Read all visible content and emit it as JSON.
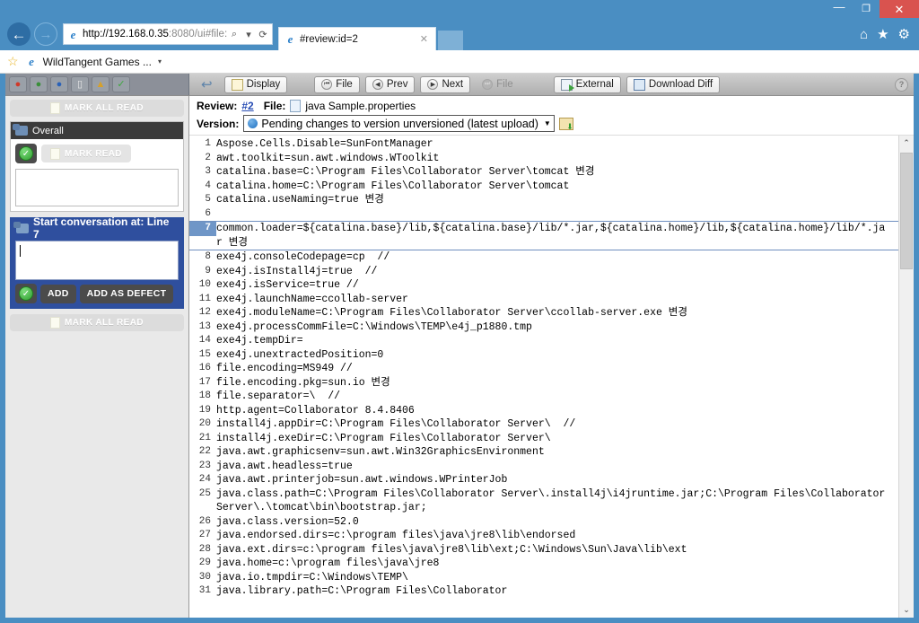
{
  "browser": {
    "window_controls": {
      "minimize": "—",
      "maximize": "❐",
      "close": "✕"
    },
    "back_arrow": "←",
    "forward_arrow": "→",
    "url_host": "http://192.168.0.35",
    "url_path": ":8080/ui#file:",
    "search_glyph": "⌕",
    "dropdown_glyph": "▾",
    "refresh_glyph": "⟳",
    "tab_title": "#review:id=2",
    "tab_close": "✕",
    "home_icon": "⌂",
    "favorites_icon": "★",
    "settings_icon": "⚙",
    "favbar": {
      "star": "☆",
      "item_label": "WildTangent Games ...",
      "caret": "▾"
    }
  },
  "toolbar": {
    "left_icons": [
      {
        "name": "defect-red-icon",
        "glyph": "🐞"
      },
      {
        "name": "defect-fixed-icon",
        "glyph": "🐞"
      },
      {
        "name": "defect-next-icon",
        "glyph": "🐞"
      },
      {
        "name": "comment-icon",
        "glyph": "💬"
      },
      {
        "name": "alert-icon",
        "glyph": "⚠"
      },
      {
        "name": "accept-icon",
        "glyph": "✓"
      }
    ],
    "undo_glyph": "↩",
    "display_label": "Display",
    "file_first_label": "File",
    "prev_label": "Prev",
    "next_label": "Next",
    "file_last_label": "File",
    "external_label": "External",
    "download_diff_label": "Download Diff",
    "help_label": "?",
    "first_glyph": "⏮",
    "prev_glyph": "◀",
    "next_glyph": "▶",
    "last_glyph": "⏭"
  },
  "sidebar": {
    "mark_all_read_top": "MARK ALL READ",
    "mark_all_read_bottom": "MARK ALL READ",
    "overall_panel": {
      "title": "Overall",
      "mark_read_label": "MARK READ",
      "comment_value": "",
      "comment_placeholder": ""
    },
    "conversation_panel": {
      "title": "Start conversation at: Line 7",
      "comment_value": "",
      "comment_placeholder": "",
      "add_label": "ADD",
      "add_as_defect_label": "ADD AS DEFECT"
    }
  },
  "review": {
    "review_label": "Review:",
    "review_id": "#2",
    "file_label": "File:",
    "file_name": "java Sample.properties",
    "version_label": "Version:",
    "version_value": "Pending changes to version unversioned (latest upload)",
    "version_caret": "▼"
  },
  "code": {
    "selected_line": 7,
    "lines": [
      {
        "n": 1,
        "text": "Aspose.Cells.Disable=SunFontManager"
      },
      {
        "n": 2,
        "text": "awt.toolkit=sun.awt.windows.WToolkit"
      },
      {
        "n": 3,
        "text": "catalina.base=C:\\Program Files\\Collaborator Server\\tomcat 변경"
      },
      {
        "n": 4,
        "text": "catalina.home=C:\\Program Files\\Collaborator Server\\tomcat"
      },
      {
        "n": 5,
        "text": "catalina.useNaming=true 변경"
      },
      {
        "n": 6,
        "text": ""
      },
      {
        "n": 7,
        "text": "common.loader=${catalina.base}/lib,${catalina.base}/lib/*.jar,${catalina.home}/lib,${catalina.home}/lib/*.jar 변경"
      },
      {
        "n": 8,
        "text": "exe4j.consoleCodepage=cp  //"
      },
      {
        "n": 9,
        "text": "exe4j.isInstall4j=true  //"
      },
      {
        "n": 10,
        "text": "exe4j.isService=true //"
      },
      {
        "n": 11,
        "text": "exe4j.launchName=ccollab-server"
      },
      {
        "n": 12,
        "text": "exe4j.moduleName=C:\\Program Files\\Collaborator Server\\ccollab-server.exe 변경"
      },
      {
        "n": 13,
        "text": "exe4j.processCommFile=C:\\Windows\\TEMP\\e4j_p1880.tmp"
      },
      {
        "n": 14,
        "text": "exe4j.tempDir="
      },
      {
        "n": 15,
        "text": "exe4j.unextractedPosition=0"
      },
      {
        "n": 16,
        "text": "file.encoding=MS949 //"
      },
      {
        "n": 17,
        "text": "file.encoding.pkg=sun.io 변경"
      },
      {
        "n": 18,
        "text": "file.separator=\\  //"
      },
      {
        "n": 19,
        "text": "http.agent=Collaborator 8.4.8406"
      },
      {
        "n": 20,
        "text": "install4j.appDir=C:\\Program Files\\Collaborator Server\\  //"
      },
      {
        "n": 21,
        "text": "install4j.exeDir=C:\\Program Files\\Collaborator Server\\"
      },
      {
        "n": 22,
        "text": "java.awt.graphicsenv=sun.awt.Win32GraphicsEnvironment"
      },
      {
        "n": 23,
        "text": "java.awt.headless=true"
      },
      {
        "n": 24,
        "text": "java.awt.printerjob=sun.awt.windows.WPrinterJob"
      },
      {
        "n": 25,
        "text": "java.class.path=C:\\Program Files\\Collaborator Server\\.install4j\\i4jruntime.jar;C:\\Program Files\\Collaborator Server\\.\\tomcat\\bin\\bootstrap.jar;"
      },
      {
        "n": 26,
        "text": "java.class.version=52.0"
      },
      {
        "n": 27,
        "text": "java.endorsed.dirs=c:\\program files\\java\\jre8\\lib\\endorsed"
      },
      {
        "n": 28,
        "text": "java.ext.dirs=c:\\program files\\java\\jre8\\lib\\ext;C:\\Windows\\Sun\\Java\\lib\\ext"
      },
      {
        "n": 29,
        "text": "java.home=c:\\program files\\java\\jre8"
      },
      {
        "n": 30,
        "text": "java.io.tmpdir=C:\\Windows\\TEMP\\"
      },
      {
        "n": 31,
        "text": "java.library.path=C:\\Program Files\\Collaborator"
      }
    ]
  },
  "scrollbar": {
    "up_glyph": "⌃",
    "down_glyph": "⌄"
  },
  "colors": {
    "browser_chrome": "#4a8ec2",
    "selection_gutter": "#6f96c7",
    "active_panel": "#2f4f9e",
    "link": "#2a4fb5"
  }
}
